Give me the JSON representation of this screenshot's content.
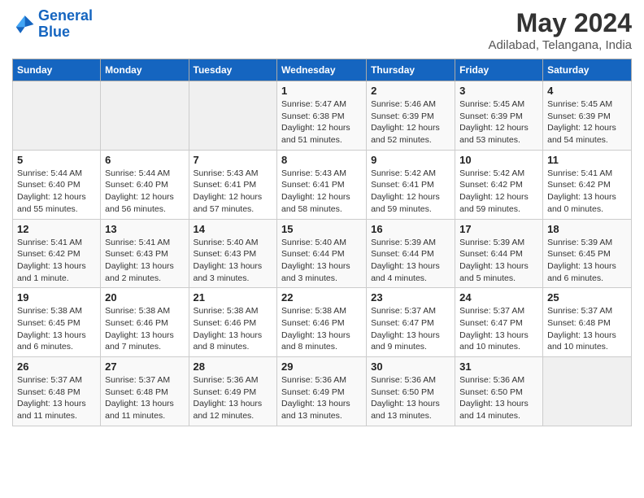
{
  "logo": {
    "line1": "General",
    "line2": "Blue"
  },
  "title": "May 2024",
  "subtitle": "Adilabad, Telangana, India",
  "weekdays": [
    "Sunday",
    "Monday",
    "Tuesday",
    "Wednesday",
    "Thursday",
    "Friday",
    "Saturday"
  ],
  "weeks": [
    [
      {
        "day": "",
        "info": ""
      },
      {
        "day": "",
        "info": ""
      },
      {
        "day": "",
        "info": ""
      },
      {
        "day": "1",
        "info": "Sunrise: 5:47 AM\nSunset: 6:38 PM\nDaylight: 12 hours\nand 51 minutes."
      },
      {
        "day": "2",
        "info": "Sunrise: 5:46 AM\nSunset: 6:39 PM\nDaylight: 12 hours\nand 52 minutes."
      },
      {
        "day": "3",
        "info": "Sunrise: 5:45 AM\nSunset: 6:39 PM\nDaylight: 12 hours\nand 53 minutes."
      },
      {
        "day": "4",
        "info": "Sunrise: 5:45 AM\nSunset: 6:39 PM\nDaylight: 12 hours\nand 54 minutes."
      }
    ],
    [
      {
        "day": "5",
        "info": "Sunrise: 5:44 AM\nSunset: 6:40 PM\nDaylight: 12 hours\nand 55 minutes."
      },
      {
        "day": "6",
        "info": "Sunrise: 5:44 AM\nSunset: 6:40 PM\nDaylight: 12 hours\nand 56 minutes."
      },
      {
        "day": "7",
        "info": "Sunrise: 5:43 AM\nSunset: 6:41 PM\nDaylight: 12 hours\nand 57 minutes."
      },
      {
        "day": "8",
        "info": "Sunrise: 5:43 AM\nSunset: 6:41 PM\nDaylight: 12 hours\nand 58 minutes."
      },
      {
        "day": "9",
        "info": "Sunrise: 5:42 AM\nSunset: 6:41 PM\nDaylight: 12 hours\nand 59 minutes."
      },
      {
        "day": "10",
        "info": "Sunrise: 5:42 AM\nSunset: 6:42 PM\nDaylight: 12 hours\nand 59 minutes."
      },
      {
        "day": "11",
        "info": "Sunrise: 5:41 AM\nSunset: 6:42 PM\nDaylight: 13 hours\nand 0 minutes."
      }
    ],
    [
      {
        "day": "12",
        "info": "Sunrise: 5:41 AM\nSunset: 6:42 PM\nDaylight: 13 hours\nand 1 minute."
      },
      {
        "day": "13",
        "info": "Sunrise: 5:41 AM\nSunset: 6:43 PM\nDaylight: 13 hours\nand 2 minutes."
      },
      {
        "day": "14",
        "info": "Sunrise: 5:40 AM\nSunset: 6:43 PM\nDaylight: 13 hours\nand 3 minutes."
      },
      {
        "day": "15",
        "info": "Sunrise: 5:40 AM\nSunset: 6:44 PM\nDaylight: 13 hours\nand 3 minutes."
      },
      {
        "day": "16",
        "info": "Sunrise: 5:39 AM\nSunset: 6:44 PM\nDaylight: 13 hours\nand 4 minutes."
      },
      {
        "day": "17",
        "info": "Sunrise: 5:39 AM\nSunset: 6:44 PM\nDaylight: 13 hours\nand 5 minutes."
      },
      {
        "day": "18",
        "info": "Sunrise: 5:39 AM\nSunset: 6:45 PM\nDaylight: 13 hours\nand 6 minutes."
      }
    ],
    [
      {
        "day": "19",
        "info": "Sunrise: 5:38 AM\nSunset: 6:45 PM\nDaylight: 13 hours\nand 6 minutes."
      },
      {
        "day": "20",
        "info": "Sunrise: 5:38 AM\nSunset: 6:46 PM\nDaylight: 13 hours\nand 7 minutes."
      },
      {
        "day": "21",
        "info": "Sunrise: 5:38 AM\nSunset: 6:46 PM\nDaylight: 13 hours\nand 8 minutes."
      },
      {
        "day": "22",
        "info": "Sunrise: 5:38 AM\nSunset: 6:46 PM\nDaylight: 13 hours\nand 8 minutes."
      },
      {
        "day": "23",
        "info": "Sunrise: 5:37 AM\nSunset: 6:47 PM\nDaylight: 13 hours\nand 9 minutes."
      },
      {
        "day": "24",
        "info": "Sunrise: 5:37 AM\nSunset: 6:47 PM\nDaylight: 13 hours\nand 10 minutes."
      },
      {
        "day": "25",
        "info": "Sunrise: 5:37 AM\nSunset: 6:48 PM\nDaylight: 13 hours\nand 10 minutes."
      }
    ],
    [
      {
        "day": "26",
        "info": "Sunrise: 5:37 AM\nSunset: 6:48 PM\nDaylight: 13 hours\nand 11 minutes."
      },
      {
        "day": "27",
        "info": "Sunrise: 5:37 AM\nSunset: 6:48 PM\nDaylight: 13 hours\nand 11 minutes."
      },
      {
        "day": "28",
        "info": "Sunrise: 5:36 AM\nSunset: 6:49 PM\nDaylight: 13 hours\nand 12 minutes."
      },
      {
        "day": "29",
        "info": "Sunrise: 5:36 AM\nSunset: 6:49 PM\nDaylight: 13 hours\nand 13 minutes."
      },
      {
        "day": "30",
        "info": "Sunrise: 5:36 AM\nSunset: 6:50 PM\nDaylight: 13 hours\nand 13 minutes."
      },
      {
        "day": "31",
        "info": "Sunrise: 5:36 AM\nSunset: 6:50 PM\nDaylight: 13 hours\nand 14 minutes."
      },
      {
        "day": "",
        "info": ""
      }
    ]
  ]
}
